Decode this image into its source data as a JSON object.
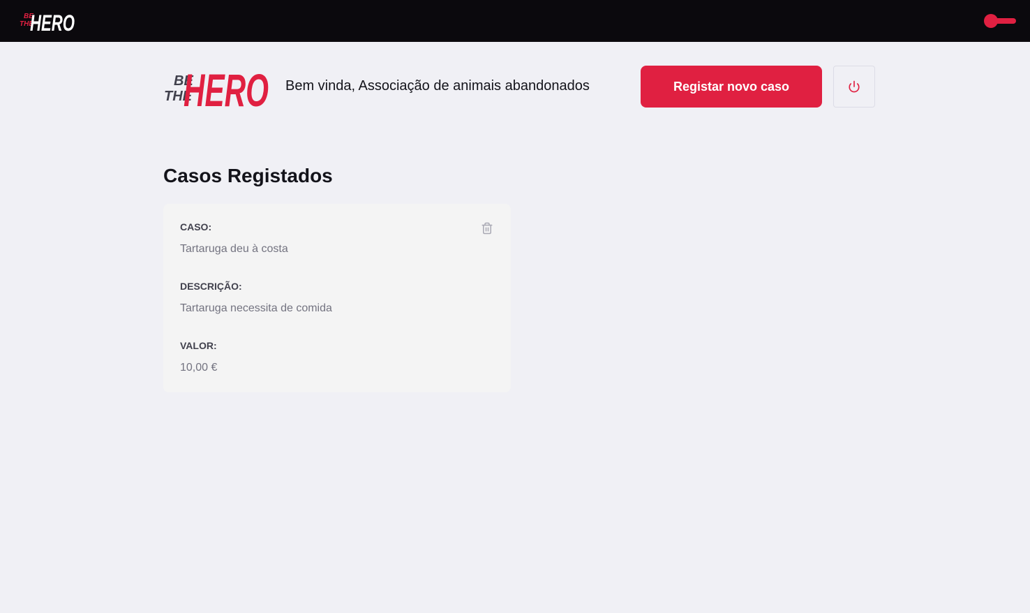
{
  "brand": {
    "logo_line1": "BE",
    "logo_line2": "THE",
    "logo_word": "HERO",
    "accent_color": "#e02041"
  },
  "topbar": {
    "theme_toggle_icon": "toggle-icon"
  },
  "header": {
    "welcome_text": "Bem vinda, Associação de animais abandonados",
    "new_case_label": "Registar novo caso",
    "logout_icon": "power-icon"
  },
  "main": {
    "title": "Casos Registados",
    "cases": [
      {
        "case_label": "CASO:",
        "case_value": "Tartaruga deu à costa",
        "description_label": "DESCRIÇÃO:",
        "description_value": "Tartaruga necessita de comida",
        "value_label": "VALOR:",
        "value_value": "10,00 €",
        "delete_icon": "trash-icon"
      }
    ]
  }
}
